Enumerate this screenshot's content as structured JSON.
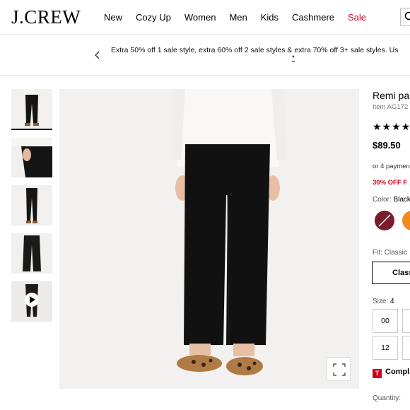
{
  "header": {
    "logo": "J.CREW",
    "nav": [
      {
        "label": "New"
      },
      {
        "label": "Cozy Up"
      },
      {
        "label": "Women"
      },
      {
        "label": "Men"
      },
      {
        "label": "Kids"
      },
      {
        "label": "Cashmere"
      },
      {
        "label": "Sale"
      }
    ],
    "icons": {
      "search": "search-icon"
    }
  },
  "promo": {
    "text": "Extra 50% off 1 sale style, extra 60% off 2 sale styles & extra 70% off 3+ sale styles. Us",
    "asterisk": "*",
    "icons": {
      "prev": "chevron-left-icon"
    }
  },
  "gallery": {
    "icons": {
      "play": "play-icon",
      "expand": "expand-icon"
    }
  },
  "product": {
    "title": "Remi par",
    "item": "Item AG172",
    "stars": "★★★★",
    "price": "$89.50",
    "installments": "or 4 paymen",
    "promo": "30% OFF F",
    "color_label": "Color:",
    "color_value": "Black",
    "swatch_colors": [
      "#7a1c2b",
      "#f08a1e"
    ],
    "fit_label": "Fit:",
    "fit_value": "Classic",
    "fit_option": "Class",
    "size_label": "Size:",
    "size_value": "4",
    "sizes": [
      "00",
      "12"
    ],
    "complete_badge": "T",
    "complete": "Compl",
    "quantity_label": "Quantity:"
  },
  "colors": {
    "sale": "#d0021b",
    "accent": "#000000"
  }
}
